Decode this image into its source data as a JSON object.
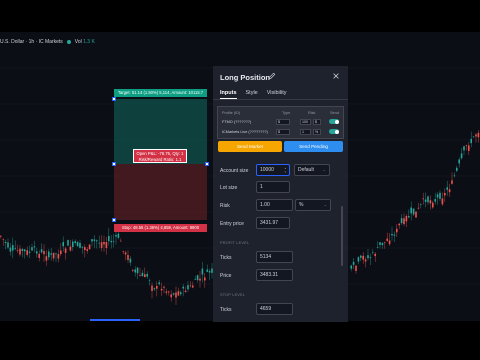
{
  "symbol": {
    "title": "U.S. Dollar · 1h · IC Markets",
    "vol_label": "Vol",
    "vol_value": "1.3 K"
  },
  "chart_overlay": {
    "target_label": "Target: 51.14 (1.50%) 5,114, Amount: 10115.7",
    "stop_label": "Stop: 48.55 (1.36%) 4,659, Amount: 9900",
    "open_line1": "Open P&L: -76.75, Qty: 1",
    "open_line2": "Risk/Reward Ratio: 1.1"
  },
  "panel": {
    "title": "Long Position",
    "tabs": [
      {
        "label": "Inputs"
      },
      {
        "label": "Style"
      },
      {
        "label": "Visibility"
      }
    ],
    "table": {
      "headers": {
        "profile": "Profile (ID)",
        "type": "Type",
        "risk": "Risk",
        "send": "Send"
      },
      "rows": [
        {
          "profile": "FTMO (???????)",
          "type": "$",
          "risk": "100",
          "mult": "$"
        },
        {
          "profile": "ICMarkets Live (????????)",
          "type": "$",
          "risk": "1",
          "mult": "%"
        }
      ]
    },
    "buttons": {
      "market": "Send Market",
      "pending": "Send Pending"
    },
    "fields": {
      "account_size_label": "Account size",
      "account_size": "10000",
      "account_size_mode": "Default",
      "lot_size_label": "Lot size",
      "lot_size": "1",
      "risk_label": "Risk",
      "risk": "1.00",
      "risk_unit": "%",
      "entry_label": "Entry price",
      "entry": "3431.97",
      "profit_section": "PROFIT LEVEL",
      "ticks_label": "Ticks",
      "profit_ticks": "5134",
      "price_label": "Price",
      "profit_price": "3483.31",
      "stop_section": "STOP LEVEL",
      "stop_ticks_label": "Ticks",
      "stop_ticks": "4659"
    }
  },
  "colors": {
    "target": "#0d9e83",
    "stop": "#d33145",
    "market_btn": "#f7a600",
    "pending_btn": "#2e8ef0",
    "accent": "#2962ff"
  }
}
